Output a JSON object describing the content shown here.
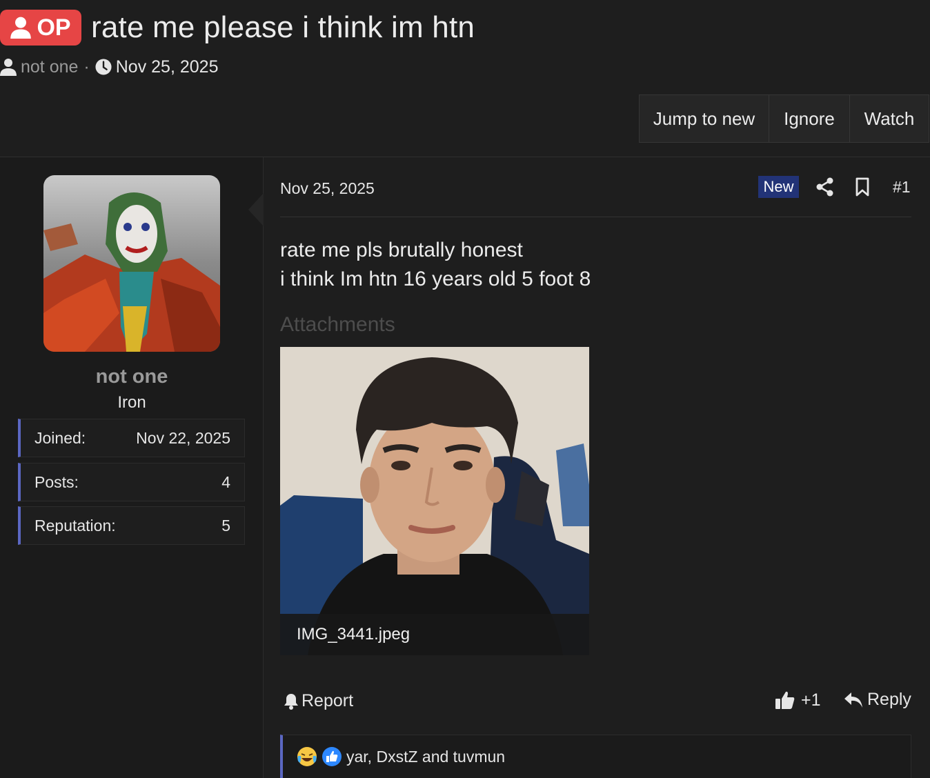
{
  "thread": {
    "op_label": "OP",
    "title": "rate me please i think im htn",
    "author": "not one",
    "separator": "·",
    "date": "Nov 25, 2025"
  },
  "actions": {
    "jump": "Jump to new",
    "ignore": "Ignore",
    "watch": "Watch"
  },
  "user": {
    "name": "not one",
    "rank": "Iron",
    "stats": [
      {
        "label": "Joined:",
        "value": "Nov 22, 2025"
      },
      {
        "label": "Posts:",
        "value": "4"
      },
      {
        "label": "Reputation:",
        "value": "5"
      }
    ]
  },
  "post": {
    "date": "Nov 25, 2025",
    "new_badge": "New",
    "number": "#1",
    "body_line1": "rate me pls brutally honest",
    "body_line2": "i think Im htn 16 years old 5 foot 8",
    "attachments_heading": "Attachments",
    "attachment_filename": "IMG_3441.jpeg",
    "report_label": "Report",
    "like_count": "+1",
    "reply_label": "Reply",
    "reactions_text": "yar, DxstZ and tuvmun"
  },
  "colors": {
    "op_badge": "#e64545",
    "accent_border": "#5b67c2",
    "new_badge": "#223377",
    "background": "#1e1e1e"
  }
}
